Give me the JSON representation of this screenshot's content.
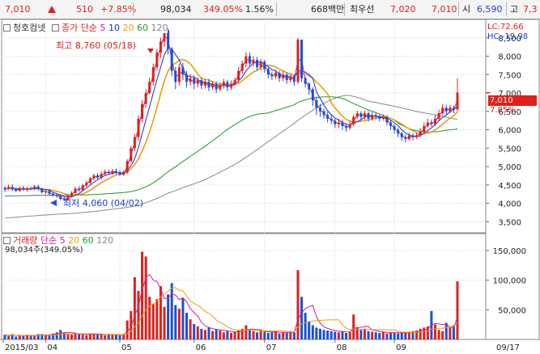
{
  "header": {
    "price": "7,010",
    "change": "510",
    "change_pct": "+7.85%",
    "volume": "98,034",
    "volume_ratio": "349.05%",
    "turnover": "1.56%",
    "trade_value": "668백만",
    "bid_label": "최우선",
    "bid_ask": "7,020",
    "bid_ask2": "7,010",
    "open_label": "시",
    "open": "6,590",
    "high_label": "고",
    "high": "7,3"
  },
  "legend": {
    "name": "청호컴넷",
    "price_ma_label": "종가 단순",
    "periods": [
      "5",
      "10",
      "20",
      "60",
      "120"
    ],
    "volume_label": "거래량",
    "volume_ma_label": "단순 5",
    "volume_periods": [
      "20",
      "60",
      "120"
    ],
    "volume_value": "98,034주(349.05%)"
  },
  "side": {
    "lc": "LC:72.66",
    "hc": "HC:-19.98",
    "current": "7,010",
    "pct": "7.85%"
  },
  "annotations": {
    "high": "최고 8,760 (05/18)",
    "low": "최저 4,060 (04/02)"
  },
  "colors": {
    "up": "#e0201a",
    "down": "#1a50d8",
    "ma5": "#d81b9a",
    "ma10": "#1a2ed0",
    "ma20": "#e8a010",
    "ma60": "#1f9a2a",
    "ma120": "#8a8a8a"
  },
  "chart_data": [
    {
      "type": "candlestick",
      "title": "",
      "yticks": [
        "3,500",
        "4,000",
        "4,500",
        "5,000",
        "5,500",
        "6,000",
        "6,500",
        "7,000",
        "7,500",
        "8,000",
        "8,500"
      ],
      "ylim": [
        3200,
        9000
      ],
      "xticks": [
        "2015/03",
        "04",
        "05",
        "06",
        "07",
        "08",
        "09",
        "09/17"
      ],
      "candles": [
        [
          4420,
          4380,
          4470,
          4300
        ],
        [
          4400,
          4450,
          4510,
          4360
        ],
        [
          4450,
          4380,
          4520,
          4330
        ],
        [
          4380,
          4340,
          4430,
          4300
        ],
        [
          4340,
          4420,
          4460,
          4310
        ],
        [
          4420,
          4370,
          4480,
          4340
        ],
        [
          4370,
          4410,
          4450,
          4320
        ],
        [
          4410,
          4390,
          4460,
          4360
        ],
        [
          4390,
          4460,
          4500,
          4360
        ],
        [
          4460,
          4390,
          4510,
          4350
        ],
        [
          4390,
          4300,
          4430,
          4270
        ],
        [
          4300,
          4330,
          4380,
          4250
        ],
        [
          4330,
          4260,
          4390,
          4220
        ],
        [
          4260,
          4230,
          4300,
          4180
        ],
        [
          4230,
          4200,
          4280,
          4150
        ],
        [
          4200,
          4120,
          4250,
          4080
        ],
        [
          4120,
          4090,
          4170,
          4060
        ],
        [
          4090,
          4200,
          4250,
          4070
        ],
        [
          4200,
          4280,
          4330,
          4160
        ],
        [
          4280,
          4400,
          4450,
          4250
        ],
        [
          4400,
          4360,
          4470,
          4310
        ],
        [
          4360,
          4490,
          4530,
          4320
        ],
        [
          4490,
          4560,
          4610,
          4440
        ],
        [
          4560,
          4680,
          4720,
          4520
        ],
        [
          4680,
          4760,
          4810,
          4620
        ],
        [
          4760,
          4700,
          4830,
          4660
        ],
        [
          4700,
          4800,
          4860,
          4650
        ],
        [
          4800,
          4860,
          4920,
          4750
        ],
        [
          4860,
          4820,
          4910,
          4770
        ],
        [
          4820,
          4880,
          4940,
          4780
        ],
        [
          4880,
          4830,
          4950,
          4790
        ],
        [
          4830,
          4780,
          4900,
          4740
        ],
        [
          4780,
          4840,
          4890,
          4740
        ],
        [
          4840,
          5150,
          5200,
          4800
        ],
        [
          5150,
          5500,
          5560,
          5100
        ],
        [
          5500,
          5800,
          5880,
          5420
        ],
        [
          5800,
          6300,
          6380,
          5700
        ],
        [
          6300,
          6700,
          6800,
          6200
        ],
        [
          6700,
          7000,
          7100,
          6600
        ],
        [
          7000,
          7300,
          7420,
          6950
        ],
        [
          7300,
          7700,
          7800,
          7200
        ],
        [
          7700,
          8100,
          8200,
          7600
        ],
        [
          8100,
          8400,
          8500,
          7950
        ],
        [
          8400,
          8700,
          8760,
          8250
        ],
        [
          8700,
          8200,
          8750,
          8050
        ],
        [
          8200,
          7600,
          8250,
          7450
        ],
        [
          7600,
          7300,
          7700,
          7100
        ],
        [
          7300,
          7700,
          7800,
          7200
        ],
        [
          7700,
          7500,
          7820,
          7350
        ],
        [
          7500,
          7300,
          7600,
          7150
        ],
        [
          7300,
          7400,
          7520,
          7200
        ],
        [
          7400,
          7250,
          7480,
          7100
        ],
        [
          7250,
          7350,
          7420,
          7150
        ],
        [
          7350,
          7200,
          7420,
          7100
        ],
        [
          7200,
          7300,
          7380,
          7120
        ],
        [
          7300,
          7150,
          7380,
          7050
        ],
        [
          7150,
          7250,
          7320,
          7080
        ],
        [
          7250,
          7100,
          7320,
          7000
        ],
        [
          7100,
          7200,
          7280,
          7050
        ],
        [
          7200,
          7300,
          7380,
          7120
        ],
        [
          7300,
          7150,
          7360,
          7050
        ],
        [
          7150,
          7250,
          7340,
          7080
        ],
        [
          7250,
          7350,
          7420,
          7200
        ],
        [
          7350,
          7600,
          7700,
          7280
        ],
        [
          7600,
          7800,
          7880,
          7520
        ],
        [
          7800,
          8000,
          8100,
          7700
        ],
        [
          8000,
          7800,
          8100,
          7700
        ],
        [
          7800,
          7900,
          8000,
          7720
        ],
        [
          7900,
          7700,
          7980,
          7600
        ],
        [
          7700,
          7850,
          7920,
          7620
        ],
        [
          7850,
          7650,
          7900,
          7550
        ],
        [
          7650,
          7500,
          7720,
          7400
        ],
        [
          7500,
          7450,
          7580,
          7350
        ],
        [
          7450,
          7550,
          7640,
          7380
        ],
        [
          7550,
          7400,
          7600,
          7300
        ],
        [
          7400,
          7500,
          7600,
          7320
        ],
        [
          7500,
          7350,
          7560,
          7250
        ],
        [
          7350,
          7450,
          7520,
          7280
        ],
        [
          7450,
          7300,
          7500,
          7200
        ],
        [
          7300,
          8450,
          8500,
          7250
        ],
        [
          8450,
          7400,
          8450,
          7300
        ],
        [
          7400,
          7250,
          7450,
          7150
        ],
        [
          7250,
          7100,
          7300,
          6950
        ],
        [
          7100,
          6800,
          7150,
          6650
        ],
        [
          6800,
          6600,
          6900,
          6400
        ],
        [
          6600,
          6500,
          6700,
          6350
        ],
        [
          6500,
          6400,
          6580,
          6300
        ],
        [
          6400,
          6300,
          6480,
          6200
        ],
        [
          6300,
          6250,
          6400,
          6150
        ],
        [
          6250,
          6150,
          6300,
          6050
        ],
        [
          6150,
          6200,
          6300,
          6050
        ],
        [
          6200,
          6100,
          6280,
          6000
        ],
        [
          6100,
          6050,
          6180,
          5950
        ],
        [
          6050,
          6150,
          6250,
          6000
        ],
        [
          6150,
          6350,
          6420,
          6100
        ],
        [
          6350,
          6450,
          6520,
          6300
        ],
        [
          6450,
          6350,
          6500,
          6250
        ],
        [
          6350,
          6450,
          6520,
          6280
        ],
        [
          6450,
          6300,
          6500,
          6220
        ],
        [
          6300,
          6400,
          6480,
          6250
        ],
        [
          6400,
          6350,
          6460,
          6270
        ],
        [
          6350,
          6300,
          6420,
          6220
        ],
        [
          6300,
          6350,
          6420,
          6250
        ],
        [
          6350,
          6200,
          6400,
          6120
        ],
        [
          6200,
          6100,
          6250,
          6000
        ],
        [
          6100,
          6000,
          6150,
          5900
        ],
        [
          6000,
          5900,
          6050,
          5800
        ],
        [
          5900,
          5800,
          5950,
          5700
        ],
        [
          5800,
          5750,
          5870,
          5650
        ],
        [
          5750,
          5850,
          5920,
          5700
        ],
        [
          5850,
          5800,
          5900,
          5720
        ],
        [
          5800,
          5850,
          5930,
          5750
        ],
        [
          5850,
          5950,
          6050,
          5800
        ],
        [
          5950,
          6100,
          6200,
          5900
        ],
        [
          6100,
          6200,
          6300,
          6050
        ],
        [
          6200,
          6150,
          6280,
          6080
        ],
        [
          6150,
          6300,
          6400,
          6100
        ],
        [
          6300,
          6450,
          6550,
          6250
        ],
        [
          6450,
          6600,
          6700,
          6400
        ],
        [
          6600,
          6500,
          6680,
          6420
        ],
        [
          6500,
          6600,
          6680,
          6450
        ],
        [
          6600,
          6550,
          6650,
          6450
        ],
        [
          6550,
          7010,
          7400,
          6500
        ]
      ]
    },
    {
      "type": "bar",
      "title": "",
      "yticks": [
        "50,000",
        "100,000",
        "150,000"
      ],
      "ylim": [
        0,
        165000
      ],
      "values": [
        8000,
        6000,
        9000,
        5000,
        7000,
        6000,
        8000,
        7000,
        6000,
        9000,
        9000,
        7000,
        8000,
        10000,
        12000,
        16000,
        11000,
        9000,
        8000,
        10000,
        9000,
        8000,
        7000,
        9000,
        10000,
        8000,
        9000,
        7000,
        8000,
        9000,
        8000,
        7000,
        9000,
        32000,
        48000,
        105000,
        82000,
        148000,
        140000,
        72000,
        60000,
        68000,
        90000,
        55000,
        76000,
        95000,
        58000,
        52000,
        70000,
        45000,
        34000,
        26000,
        22000,
        18000,
        16000,
        20000,
        14000,
        17000,
        15000,
        12000,
        14000,
        11000,
        13000,
        15000,
        18000,
        24000,
        16000,
        14000,
        12000,
        15000,
        13000,
        11000,
        12000,
        14000,
        10000,
        12000,
        11000,
        14000,
        12000,
        117000,
        72000,
        45000,
        30000,
        24000,
        20000,
        18000,
        16000,
        15000,
        14000,
        13000,
        12000,
        14000,
        11000,
        13000,
        42000,
        20000,
        16000,
        18000,
        14000,
        13000,
        12000,
        11000,
        13000,
        10000,
        12000,
        11000,
        10000,
        12000,
        11000,
        13000,
        14000,
        15000,
        18000,
        20000,
        22000,
        48000,
        25000,
        16000,
        14000,
        28000,
        20000,
        24000,
        98034
      ]
    }
  ]
}
